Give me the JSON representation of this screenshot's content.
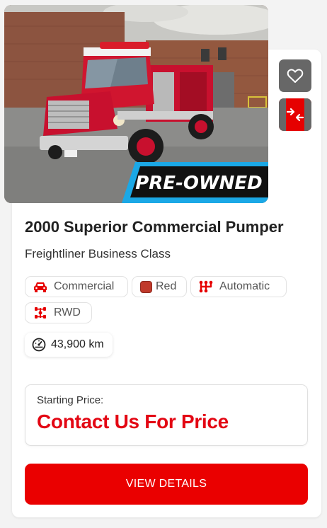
{
  "listing": {
    "image_badge": "PRE-OWNED",
    "title": "2000 Superior Commercial Pumper",
    "subtitle": "Freightliner Business Class",
    "specs": [
      {
        "icon": "car-icon",
        "label": "Commercial"
      },
      {
        "icon": "color-swatch-icon",
        "label": "Red",
        "swatch": "#c0392b"
      },
      {
        "icon": "transmission-icon",
        "label": "Automatic"
      },
      {
        "icon": "drivetrain-icon",
        "label": "RWD"
      }
    ],
    "mileage": "43,900 km",
    "mileage_icon": "speedometer-icon",
    "price_label": "Starting Price:",
    "price_value": "Contact Us For Price",
    "cta_label": "VIEW DETAILS"
  },
  "actions": {
    "favorite_icon": "heart-icon",
    "compare_icon": "compare-arrows-icon"
  },
  "colors": {
    "accent": "#e30613",
    "button": "#ea0000",
    "icon_red": "#e60000",
    "action_gray": "#676767"
  }
}
